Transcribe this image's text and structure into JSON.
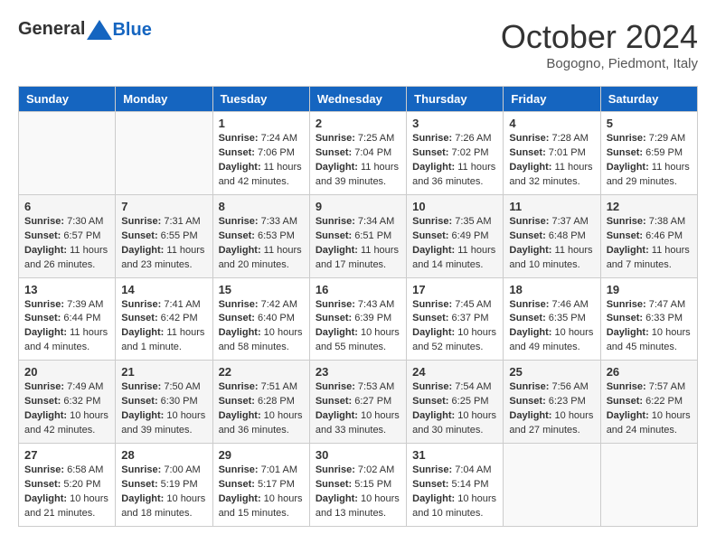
{
  "header": {
    "logo_general": "General",
    "logo_blue": "Blue",
    "month_title": "October 2024",
    "subtitle": "Bogogno, Piedmont, Italy"
  },
  "days_of_week": [
    "Sunday",
    "Monday",
    "Tuesday",
    "Wednesday",
    "Thursday",
    "Friday",
    "Saturday"
  ],
  "weeks": [
    [
      {
        "day": "",
        "content": ""
      },
      {
        "day": "",
        "content": ""
      },
      {
        "day": "1",
        "content": "Sunrise: 7:24 AM\nSunset: 7:06 PM\nDaylight: 11 hours and 42 minutes."
      },
      {
        "day": "2",
        "content": "Sunrise: 7:25 AM\nSunset: 7:04 PM\nDaylight: 11 hours and 39 minutes."
      },
      {
        "day": "3",
        "content": "Sunrise: 7:26 AM\nSunset: 7:02 PM\nDaylight: 11 hours and 36 minutes."
      },
      {
        "day": "4",
        "content": "Sunrise: 7:28 AM\nSunset: 7:01 PM\nDaylight: 11 hours and 32 minutes."
      },
      {
        "day": "5",
        "content": "Sunrise: 7:29 AM\nSunset: 6:59 PM\nDaylight: 11 hours and 29 minutes."
      }
    ],
    [
      {
        "day": "6",
        "content": "Sunrise: 7:30 AM\nSunset: 6:57 PM\nDaylight: 11 hours and 26 minutes."
      },
      {
        "day": "7",
        "content": "Sunrise: 7:31 AM\nSunset: 6:55 PM\nDaylight: 11 hours and 23 minutes."
      },
      {
        "day": "8",
        "content": "Sunrise: 7:33 AM\nSunset: 6:53 PM\nDaylight: 11 hours and 20 minutes."
      },
      {
        "day": "9",
        "content": "Sunrise: 7:34 AM\nSunset: 6:51 PM\nDaylight: 11 hours and 17 minutes."
      },
      {
        "day": "10",
        "content": "Sunrise: 7:35 AM\nSunset: 6:49 PM\nDaylight: 11 hours and 14 minutes."
      },
      {
        "day": "11",
        "content": "Sunrise: 7:37 AM\nSunset: 6:48 PM\nDaylight: 11 hours and 10 minutes."
      },
      {
        "day": "12",
        "content": "Sunrise: 7:38 AM\nSunset: 6:46 PM\nDaylight: 11 hours and 7 minutes."
      }
    ],
    [
      {
        "day": "13",
        "content": "Sunrise: 7:39 AM\nSunset: 6:44 PM\nDaylight: 11 hours and 4 minutes."
      },
      {
        "day": "14",
        "content": "Sunrise: 7:41 AM\nSunset: 6:42 PM\nDaylight: 11 hours and 1 minute."
      },
      {
        "day": "15",
        "content": "Sunrise: 7:42 AM\nSunset: 6:40 PM\nDaylight: 10 hours and 58 minutes."
      },
      {
        "day": "16",
        "content": "Sunrise: 7:43 AM\nSunset: 6:39 PM\nDaylight: 10 hours and 55 minutes."
      },
      {
        "day": "17",
        "content": "Sunrise: 7:45 AM\nSunset: 6:37 PM\nDaylight: 10 hours and 52 minutes."
      },
      {
        "day": "18",
        "content": "Sunrise: 7:46 AM\nSunset: 6:35 PM\nDaylight: 10 hours and 49 minutes."
      },
      {
        "day": "19",
        "content": "Sunrise: 7:47 AM\nSunset: 6:33 PM\nDaylight: 10 hours and 45 minutes."
      }
    ],
    [
      {
        "day": "20",
        "content": "Sunrise: 7:49 AM\nSunset: 6:32 PM\nDaylight: 10 hours and 42 minutes."
      },
      {
        "day": "21",
        "content": "Sunrise: 7:50 AM\nSunset: 6:30 PM\nDaylight: 10 hours and 39 minutes."
      },
      {
        "day": "22",
        "content": "Sunrise: 7:51 AM\nSunset: 6:28 PM\nDaylight: 10 hours and 36 minutes."
      },
      {
        "day": "23",
        "content": "Sunrise: 7:53 AM\nSunset: 6:27 PM\nDaylight: 10 hours and 33 minutes."
      },
      {
        "day": "24",
        "content": "Sunrise: 7:54 AM\nSunset: 6:25 PM\nDaylight: 10 hours and 30 minutes."
      },
      {
        "day": "25",
        "content": "Sunrise: 7:56 AM\nSunset: 6:23 PM\nDaylight: 10 hours and 27 minutes."
      },
      {
        "day": "26",
        "content": "Sunrise: 7:57 AM\nSunset: 6:22 PM\nDaylight: 10 hours and 24 minutes."
      }
    ],
    [
      {
        "day": "27",
        "content": "Sunrise: 6:58 AM\nSunset: 5:20 PM\nDaylight: 10 hours and 21 minutes."
      },
      {
        "day": "28",
        "content": "Sunrise: 7:00 AM\nSunset: 5:19 PM\nDaylight: 10 hours and 18 minutes."
      },
      {
        "day": "29",
        "content": "Sunrise: 7:01 AM\nSunset: 5:17 PM\nDaylight: 10 hours and 15 minutes."
      },
      {
        "day": "30",
        "content": "Sunrise: 7:02 AM\nSunset: 5:15 PM\nDaylight: 10 hours and 13 minutes."
      },
      {
        "day": "31",
        "content": "Sunrise: 7:04 AM\nSunset: 5:14 PM\nDaylight: 10 hours and 10 minutes."
      },
      {
        "day": "",
        "content": ""
      },
      {
        "day": "",
        "content": ""
      }
    ]
  ]
}
